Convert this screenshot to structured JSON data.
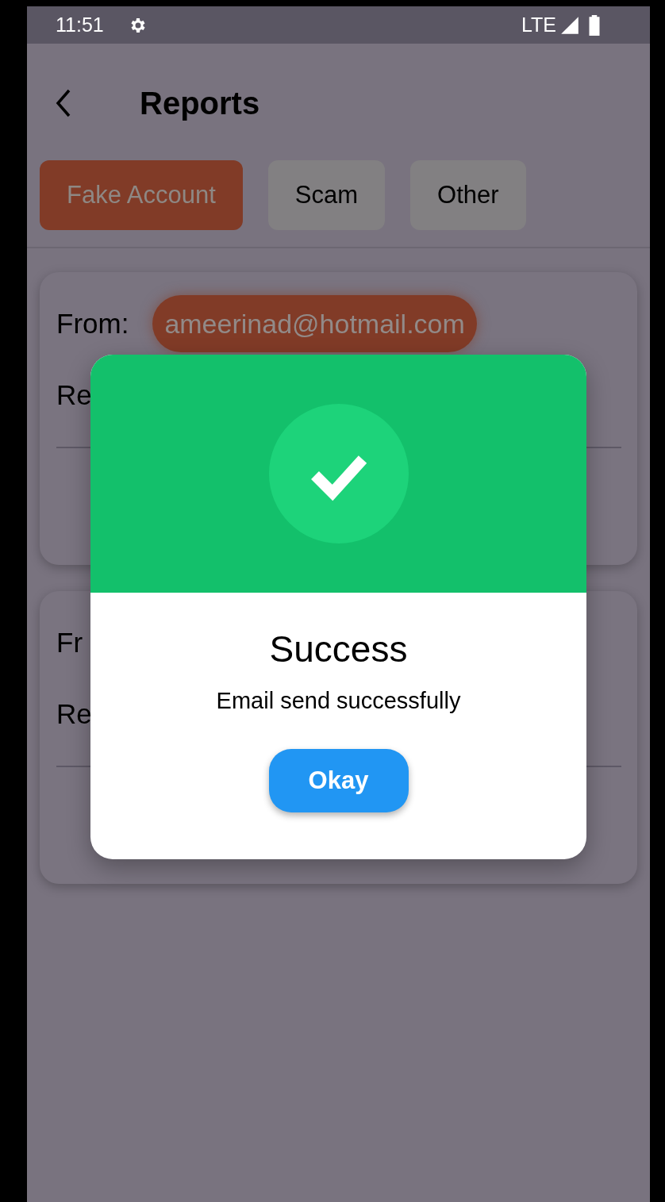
{
  "status_bar": {
    "time": "11:51",
    "network": "LTE"
  },
  "header": {
    "title": "Reports"
  },
  "tabs": [
    {
      "label": "Fake Account",
      "selected": true
    },
    {
      "label": "Scam",
      "selected": false
    },
    {
      "label": "Other",
      "selected": false
    }
  ],
  "cards": [
    {
      "from_label": "From:",
      "from_value": "ameerinad@hotmail.com",
      "row_2": "Re"
    },
    {
      "from_label": "Fr",
      "row_2": "Re"
    }
  ],
  "dialog": {
    "title": "Success",
    "message": "Email send successfully",
    "button": "Okay"
  }
}
